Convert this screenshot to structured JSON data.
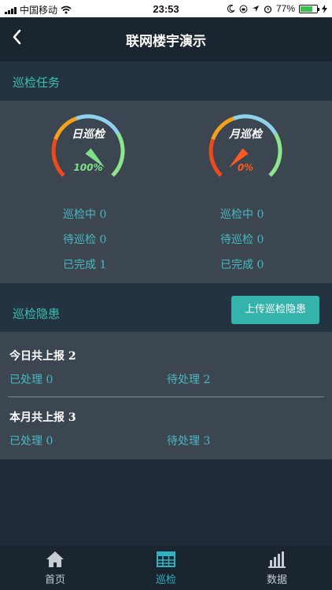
{
  "status_bar": {
    "carrier": "中国移动",
    "time": "23:53",
    "battery_percent": "77%",
    "battery_level": 0.77
  },
  "nav": {
    "title": "联网楼宇演示",
    "back_icon": "chevron-left-icon"
  },
  "inspection_tasks": {
    "header": "巡检任务",
    "gauges": [
      {
        "title": "日巡检",
        "percent_label": "100%",
        "value": 1.0,
        "pct_color": "#7fe08a",
        "stats": [
          "巡检中 0",
          "待巡检 0",
          "已完成 1"
        ]
      },
      {
        "title": "月巡检",
        "percent_label": "0%",
        "value": 0.0,
        "pct_color": "#ff5a1f",
        "stats": [
          "巡检中 0",
          "待巡检 0",
          "已完成 0"
        ]
      }
    ]
  },
  "hazards": {
    "header": "巡检隐患",
    "upload_button": "上传巡检隐患",
    "today": {
      "title": "今日共上报 2",
      "processed": "已处理 0",
      "pending": "待处理 2"
    },
    "month": {
      "title": "本月共上报 3",
      "processed": "已处理 0",
      "pending": "待处理 3"
    }
  },
  "tab_bar": {
    "tabs": [
      {
        "label": "首页",
        "icon": "home-icon",
        "active": false
      },
      {
        "label": "巡检",
        "icon": "table-icon",
        "active": true
      },
      {
        "label": "数据",
        "icon": "bar-chart-icon",
        "active": false
      }
    ]
  },
  "colors": {
    "accent": "#39c0b5",
    "background": "#1f2b36",
    "panel": "#3b4651",
    "button": "#33b3ab"
  }
}
